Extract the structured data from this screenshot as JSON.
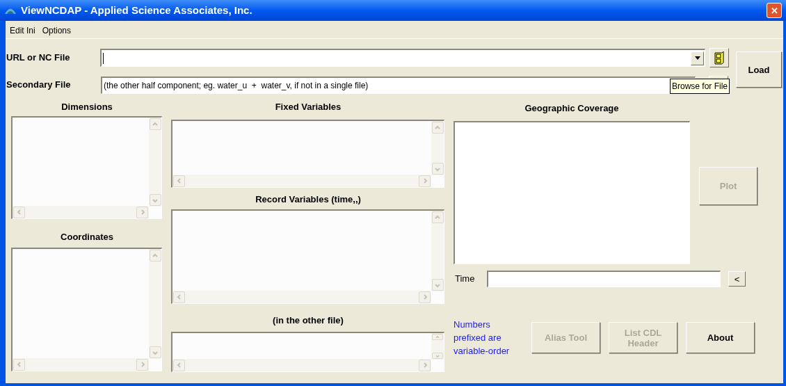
{
  "window": {
    "title": "ViewNCDAP - Applied Science Associates, Inc.",
    "close": "✕"
  },
  "menu": [
    {
      "label": "Edit Ini"
    },
    {
      "label": "Options"
    }
  ],
  "url_field": {
    "label": "URL or NC File"
  },
  "secondary_field": {
    "label": "Secondary File",
    "value": "(the other half component; eg. water_u  +  water_v, if not in a single file)"
  },
  "load_button": {
    "label": "Load"
  },
  "tooltip": "Browse for File",
  "left_lists": [
    {
      "heading": "Dimensions"
    },
    {
      "heading": "Coordinates"
    }
  ],
  "middle_lists": [
    {
      "heading": "Fixed Variables"
    },
    {
      "heading": "Record Variables (time,,)"
    },
    {
      "heading": "(in the other file)"
    }
  ],
  "geographic_coverage": {
    "heading": "Geographic Coverage"
  },
  "plot_button": {
    "label": "Plot",
    "disabled": true
  },
  "time_field": {
    "label": "Time",
    "step_button": "<"
  },
  "note": "Numbers prefixed are variable-order",
  "buttons": [
    {
      "label": "Alias Tool",
      "disabled": true
    },
    {
      "label": "List CDL Header",
      "disabled": true
    },
    {
      "label": "About",
      "disabled": false
    }
  ]
}
